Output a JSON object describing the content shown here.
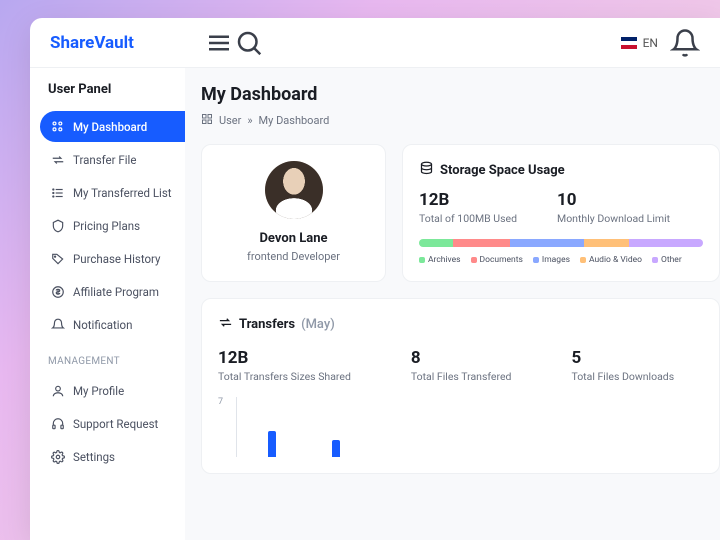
{
  "brand": "ShareVault",
  "lang": "EN",
  "sidebar": {
    "panel_title": "User Panel",
    "items": [
      {
        "label": "My Dashboard"
      },
      {
        "label": "Transfer File"
      },
      {
        "label": "My Transferred List"
      },
      {
        "label": "Pricing Plans"
      },
      {
        "label": "Purchase History"
      },
      {
        "label": "Affiliate Program"
      },
      {
        "label": "Notification"
      }
    ],
    "mgmt_label": "MANAGEMENT",
    "mgmt": [
      {
        "label": "My Profile"
      },
      {
        "label": "Support Request"
      },
      {
        "label": "Settings"
      }
    ]
  },
  "page": {
    "title": "My Dashboard",
    "breadcrumb": {
      "root": "User",
      "current": "My Dashboard"
    }
  },
  "profile": {
    "name": "Devon Lane",
    "role": "frontend Developer"
  },
  "storage": {
    "title": "Storage Space Usage",
    "stats": [
      {
        "value": "12B",
        "label": "Total of 100MB Used"
      },
      {
        "value": "10",
        "label": "Monthly Download Limit"
      }
    ],
    "legend": [
      "Archives",
      "Documents",
      "Images",
      "Audio & Video",
      "Other"
    ]
  },
  "transfers": {
    "title": "Transfers",
    "month": "(May)",
    "stats": [
      {
        "value": "12B",
        "label": "Total Transfers Sizes Shared"
      },
      {
        "value": "8",
        "label": "Total Files Transfered"
      },
      {
        "value": "5",
        "label": "Total Files Downloads"
      }
    ]
  },
  "chart_data": {
    "type": "bar",
    "ylabel": "7",
    "values": [
      3,
      2
    ],
    "ylim": [
      0,
      7
    ]
  }
}
